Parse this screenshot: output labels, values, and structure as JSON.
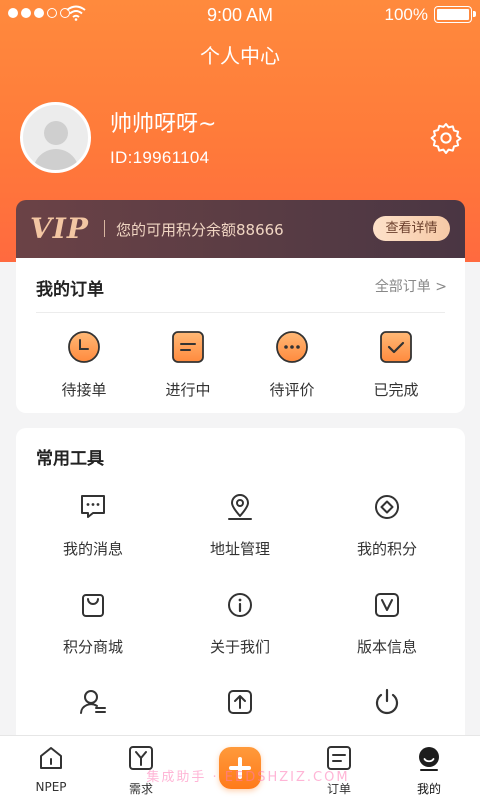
{
  "status_bar": {
    "time": "9:00 AM",
    "battery": "100%"
  },
  "header": {
    "title": "个人中心"
  },
  "profile": {
    "name": "帅帅呀呀~",
    "id": "ID:19961104"
  },
  "vip": {
    "logo": "VIP",
    "text": "您的可用积分余额88666",
    "button": "查看详情"
  },
  "orders": {
    "title": "我的订单",
    "all_link": "全部订单 >",
    "items": [
      {
        "label": "待接单",
        "icon": "clock-icon"
      },
      {
        "label": "进行中",
        "icon": "in-progress-icon"
      },
      {
        "label": "待评价",
        "icon": "comment-icon"
      },
      {
        "label": "已完成",
        "icon": "check-icon"
      }
    ]
  },
  "tools": {
    "title": "常用工具",
    "items": [
      {
        "label": "我的消息",
        "icon": "message-icon"
      },
      {
        "label": "地址管理",
        "icon": "location-icon"
      },
      {
        "label": "我的积分",
        "icon": "points-icon"
      },
      {
        "label": "积分商城",
        "icon": "shopping-bag-icon"
      },
      {
        "label": "关于我们",
        "icon": "info-icon"
      },
      {
        "label": "版本信息",
        "icon": "version-icon"
      },
      {
        "label": "",
        "icon": "user-manage-icon"
      },
      {
        "label": "",
        "icon": "upload-icon"
      },
      {
        "label": "",
        "icon": "power-icon"
      }
    ]
  },
  "tabbar": {
    "items": [
      {
        "label": "NPEP",
        "icon": "home-icon"
      },
      {
        "label": "需求",
        "icon": "demand-icon"
      },
      {
        "label": "",
        "icon": "plus-icon"
      },
      {
        "label": "订单",
        "icon": "order-icon"
      },
      {
        "label": "我的",
        "icon": "profile-icon"
      }
    ],
    "active": "我的",
    "watermark": "集成助手 · EEDSHZIZ.COM"
  },
  "colors": {
    "accent": "#ff7a3a",
    "vip_bg": "#593c44",
    "vip_gold": "#f3c6a3"
  }
}
